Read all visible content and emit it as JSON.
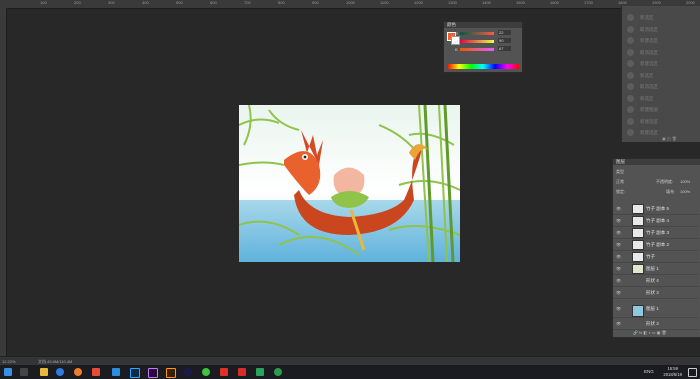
{
  "ruler": {
    "ticks": [
      "100",
      "200",
      "300",
      "400",
      "500",
      "600",
      "700",
      "800",
      "900",
      "1000",
      "1100",
      "1200",
      "1300",
      "1400",
      "1500",
      "1600",
      "1700",
      "1800",
      "1900",
      "2000"
    ]
  },
  "color_panel": {
    "title": "颜色",
    "sliders": [
      {
        "label": "R",
        "value": "22"
      },
      {
        "label": "G",
        "value": "90"
      },
      {
        "label": "B",
        "value": "67"
      }
    ]
  },
  "history": {
    "items": [
      "新选区",
      "取消选区",
      "新建选区",
      "取消选区",
      "新建选区",
      "新选区",
      "取消选区",
      "新选区",
      "新建图层",
      "新建选区",
      "新建选区",
      "删除图层"
    ]
  },
  "layers": {
    "title": "图层",
    "tabs": [
      "图层",
      "通道",
      "路径"
    ],
    "kind_label": "类型",
    "blend_mode": "正常",
    "opacity_label": "不透明度:",
    "opacity_value": "100%",
    "lock_label": "锁定:",
    "fill_label": "填充:",
    "fill_value": "100%",
    "items": [
      {
        "name": "竹子 副本 5",
        "eye": "👁"
      },
      {
        "name": "竹子 副本 4",
        "eye": "👁"
      },
      {
        "name": "竹子 副本 3",
        "eye": "👁"
      },
      {
        "name": "竹子 副本 2",
        "eye": "👁"
      },
      {
        "name": "竹子",
        "eye": "👁"
      },
      {
        "name": "图层 1",
        "eye": "👁"
      },
      {
        "name": "形状 4",
        "eye": "👁"
      },
      {
        "name": "形状 3",
        "eye": "👁"
      },
      {
        "name": "图层 1",
        "eye": "👁"
      },
      {
        "name": "形状 3",
        "eye": "👁"
      }
    ]
  },
  "status_bar": {
    "zoom": "12.22%",
    "doc_info": "文档:45.6M/110.4M"
  },
  "taskbar": {
    "lang": "ENG",
    "time": "16:59",
    "date": "2018/5/19"
  },
  "colors": {
    "boat": "#c9461f",
    "dragon": "#e9612d",
    "bamboo": "#8fc34a",
    "water": "#7fc2e3",
    "sky": "#eef7f1"
  }
}
